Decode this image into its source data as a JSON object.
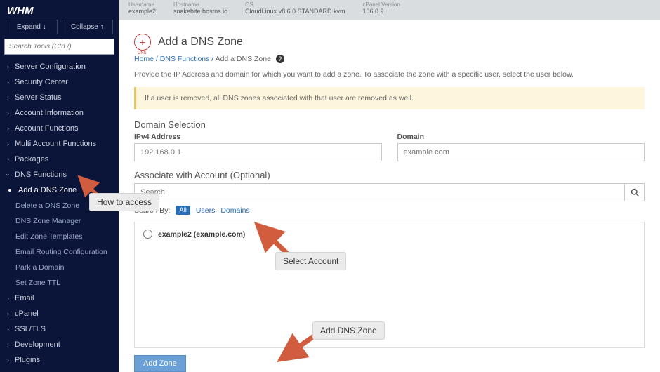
{
  "topbar": {
    "username_lbl": "Username",
    "username": "example2",
    "hostname_lbl": "Hostname",
    "hostname": "snakebite.hostns.io",
    "os_lbl": "OS",
    "os": "CloudLinux v8.6.0 STANDARD kvm",
    "cpver_lbl": "cPanel Version",
    "cpver": "106.0.9"
  },
  "sidebar": {
    "logo": "WHM",
    "expand": "Expand",
    "collapse": "Collapse",
    "search_placeholder": "Search Tools (Ctrl /)",
    "cats": [
      "Server Configuration",
      "Security Center",
      "Server Status",
      "Account Information",
      "Account Functions",
      "Multi Account Functions",
      "Packages",
      "DNS Functions"
    ],
    "current": "Add a DNS Zone",
    "subs": [
      "Delete a DNS Zone",
      "DNS Zone Manager",
      "Edit Zone Templates",
      "Email Routing Configuration",
      "Park a Domain",
      "Set Zone TTL"
    ],
    "cats_after": [
      "Email",
      "cPanel",
      "SSL/TLS",
      "Development",
      "Plugins"
    ]
  },
  "page": {
    "title": "Add a DNS Zone",
    "plus_sub": "DNS",
    "breadcrumb_home": "Home",
    "breadcrumb_dns": "DNS Functions",
    "breadcrumb_cur": "Add a DNS Zone",
    "desc": "Provide the IP Address and domain for which you want to add a zone. To associate the zone with a specific user, select the user below.",
    "warn": "If a user is removed, all DNS zones associated with that user are removed as well.",
    "domain_selection": "Domain Selection",
    "ipv4_label": "IPv4 Address",
    "ipv4_placeholder": "192.168.0.1",
    "domain_label": "Domain",
    "domain_placeholder": "example.com",
    "assoc_header": "Associate with Account (Optional)",
    "assoc_search_placeholder": "Search",
    "searchby_label": "Search By:",
    "filter_all": "All",
    "filter_users": "Users",
    "filter_domains": "Domains",
    "account_entry": "example2 (example.com)",
    "add_zone_btn": "Add Zone"
  },
  "annotations": {
    "how_to_access": "How to access",
    "select_account": "Select Account",
    "add_dns_zone": "Add DNS Zone"
  }
}
